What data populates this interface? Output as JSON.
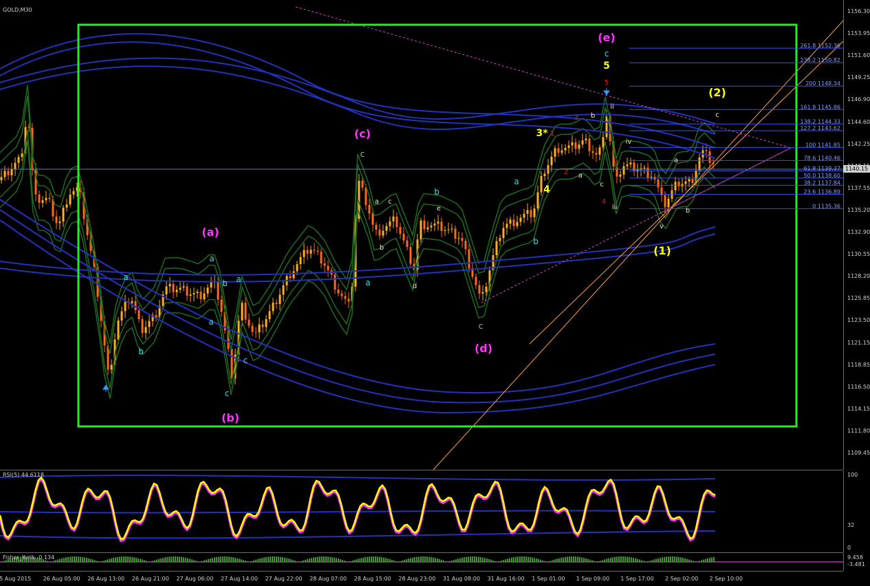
{
  "chart": {
    "symbol_label": "GOLD,M30",
    "current_price": "1140.15",
    "rsi_label": "RSI(5) 44.6118",
    "fisher_label": "Fisher_Yurik -0.134"
  },
  "price_axis": [
    "1156.30",
    "1153.95",
    "1151.60",
    "1149.25",
    "1146.90",
    "1144.60",
    "1142.25",
    "1140.15",
    "1137.55",
    "1135.20",
    "1132.90",
    "1130.55",
    "1128.20",
    "1125.85",
    "1123.50",
    "1121.15",
    "1118.85",
    "1116.50",
    "1114.15",
    "1111.80",
    "1109.45"
  ],
  "rsi_axis": [
    "100",
    "32",
    "0"
  ],
  "fisher_axis": [
    "9.458",
    "-3.481"
  ],
  "time_axis": [
    "25 Aug 2015",
    "26 Aug 05:00",
    "26 Aug 13:00",
    "26 Aug 21:00",
    "27 Aug 06:00",
    "27 Aug 14:00",
    "27 Aug 22:00",
    "28 Aug 07:00",
    "28 Aug 15:00",
    "28 Aug 23:00",
    "31 Aug 08:00",
    "31 Aug 16:00",
    "1 Sep 01:00",
    "1 Sep 09:00",
    "1 Sep 17:00",
    "2 Sep 02:00",
    "2 Sep 10:00"
  ],
  "fib_levels": [
    {
      "text": "261.8 1152.36",
      "price": 1152.36
    },
    {
      "text": "238.2 1150.82",
      "price": 1150.82
    },
    {
      "text": "200 1148.34",
      "price": 1148.34
    },
    {
      "text": "161.8 1145.86",
      "price": 1145.86
    },
    {
      "text": "138.2 1144.33",
      "price": 1144.33
    },
    {
      "text": "127.2 1143.62",
      "price": 1143.62
    },
    {
      "text": "100 1141.85",
      "price": 1141.85
    },
    {
      "text": "78.6 1140.46",
      "price": 1140.46
    },
    {
      "text": "61.8 1139.37",
      "price": 1139.37
    },
    {
      "text": "50.0 1138.60",
      "price": 1138.6
    },
    {
      "text": "38.2 1137.84",
      "price": 1137.84
    },
    {
      "text": "23.6 1136.89",
      "price": 1136.89
    },
    {
      "text": "0 1135.36",
      "price": 1135.36
    }
  ],
  "wave_labels": [
    {
      "text": "(a)",
      "color": "#ff33ff"
    },
    {
      "text": "(b)",
      "color": "#ff33ff"
    },
    {
      "text": "(c)",
      "color": "#ff33ff"
    },
    {
      "text": "(d)",
      "color": "#ff33ff"
    },
    {
      "text": "(e)",
      "color": "#ff33ff"
    },
    {
      "text": "(1)",
      "color": "#ffff00"
    },
    {
      "text": "(2)",
      "color": "#ffff00"
    },
    {
      "text": "a",
      "color": "#33dddd"
    },
    {
      "text": "b",
      "color": "#33dddd"
    },
    {
      "text": "c",
      "color": "#33dddd"
    },
    {
      "text": "a",
      "color": "#33dddd"
    },
    {
      "text": "b",
      "color": "#33dddd"
    },
    {
      "text": "a",
      "color": "#33dddd"
    },
    {
      "text": "c",
      "color": "#33dddd"
    },
    {
      "text": "a",
      "color": "#33dddd"
    },
    {
      "text": "c",
      "color": "#33dddd"
    },
    {
      "text": "a",
      "color": "#33dddd"
    },
    {
      "text": "c",
      "color": "#33dddd"
    },
    {
      "text": "b",
      "color": "#33dddd"
    },
    {
      "text": "c",
      "color": "#33dddd"
    },
    {
      "text": "a",
      "color": "#33dddd"
    },
    {
      "text": "b",
      "color": "#33dddd"
    },
    {
      "text": "c",
      "color": "#33dddd"
    },
    {
      "text": "a",
      "color": "#f0e6c8"
    },
    {
      "text": "c",
      "color": "#f0e6c8"
    },
    {
      "text": "b",
      "color": "#f0e6c8"
    },
    {
      "text": "e",
      "color": "#f0e6c8"
    },
    {
      "text": "d",
      "color": "#f0e6c8"
    },
    {
      "text": "b",
      "color": "#f0e6c8"
    },
    {
      "text": "a",
      "color": "#f0e6c8"
    },
    {
      "text": "c",
      "color": "#f0e6c8"
    },
    {
      "text": "ii",
      "color": "#f0e6c8"
    },
    {
      "text": "iv",
      "color": "#f0e6c8"
    },
    {
      "text": "iii",
      "color": "#f0e6c8"
    },
    {
      "text": "v",
      "color": "#f0e6c8"
    },
    {
      "text": "a",
      "color": "#f0e6c8"
    },
    {
      "text": "b",
      "color": "#f0e6c8"
    },
    {
      "text": "c",
      "color": "#f0e6c8"
    },
    {
      "text": "3*",
      "color": "#ffff00"
    },
    {
      "text": "4",
      "color": "#ffff00"
    },
    {
      "text": "5",
      "color": "#ffff00"
    },
    {
      "text": "1",
      "color": "#dd2222"
    },
    {
      "text": "2",
      "color": "#dd2222"
    },
    {
      "text": "3",
      "color": "#dd2222"
    },
    {
      "text": "4",
      "color": "#dd2222"
    },
    {
      "text": "5",
      "color": "#dd2222"
    }
  ],
  "colors": {
    "bull": "#ffb020",
    "bear": "#ff6a1a",
    "box": "#22ee22",
    "bands_blue": "#2233bb",
    "bands_green": "#1e6b1e",
    "rsi_yellow": "#ffff00",
    "rsi_magenta": "#ff33ff",
    "trendline": "#ffa040"
  }
}
